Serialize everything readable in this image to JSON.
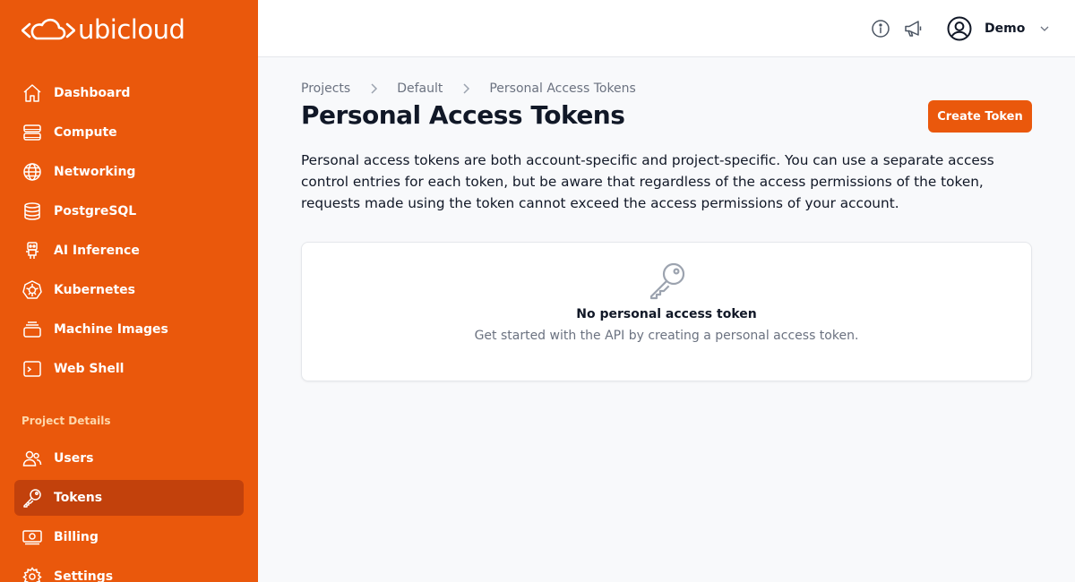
{
  "brand": {
    "name": "ubicloud"
  },
  "sidebar": {
    "main_items": [
      {
        "label": "Dashboard",
        "icon": "home-icon"
      },
      {
        "label": "Compute",
        "icon": "server-icon"
      },
      {
        "label": "Networking",
        "icon": "globe-icon"
      },
      {
        "label": "PostgreSQL",
        "icon": "database-icon"
      },
      {
        "label": "AI Inference",
        "icon": "robot-icon"
      },
      {
        "label": "Kubernetes",
        "icon": "kubernetes-icon"
      },
      {
        "label": "Machine Images",
        "icon": "stack-icon"
      },
      {
        "label": "Web Shell",
        "icon": "terminal-icon"
      }
    ],
    "section_label": "Project Details",
    "project_items": [
      {
        "label": "Users",
        "icon": "users-icon"
      },
      {
        "label": "Tokens",
        "icon": "key-icon",
        "active": true
      },
      {
        "label": "Billing",
        "icon": "banknote-icon"
      },
      {
        "label": "Settings",
        "icon": "gear-icon"
      }
    ],
    "bg_color": "#ea580c",
    "active_color": "#c2410c"
  },
  "header": {
    "icons": [
      "info-icon",
      "megaphone-icon"
    ],
    "user_name": "Demo"
  },
  "breadcrumb": [
    "Projects",
    "Default",
    "Personal Access Tokens"
  ],
  "page": {
    "title": "Personal Access Tokens",
    "create_button": "Create Token",
    "description": "Personal access tokens are both account-specific and project-specific. You can use a separate access control entries for each token, but be aware that regardless of the access permissions of the token, requests made using the token cannot exceed the access permissions of your account."
  },
  "empty_state": {
    "icon": "key-icon",
    "title": "No personal access token",
    "subtitle": "Get started with the API by creating a personal access token."
  }
}
